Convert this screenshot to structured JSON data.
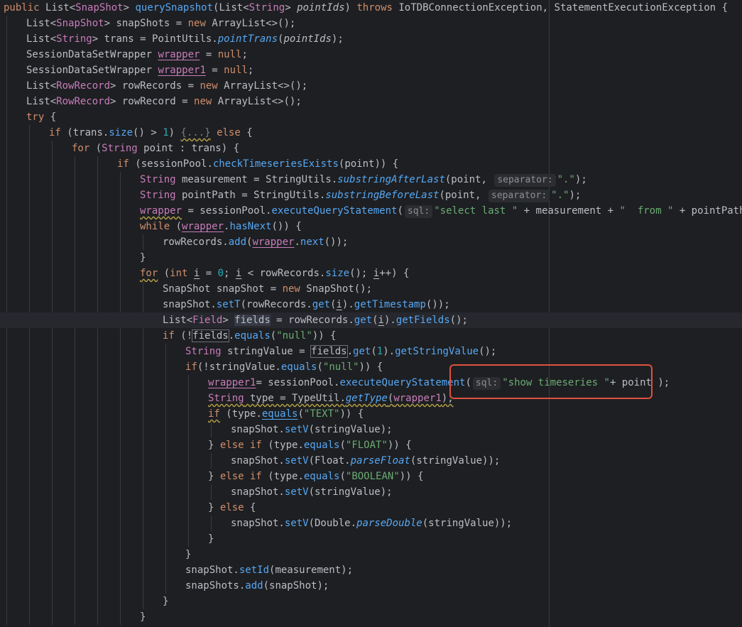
{
  "editor": {
    "lines": [
      {
        "indent": 0,
        "tokens": [
          {
            "t": "public ",
            "c": "kw"
          },
          {
            "t": "List<"
          },
          {
            "t": "SnapShot",
            "c": "ty"
          },
          {
            "t": "> "
          },
          {
            "t": "querySnapshot",
            "c": "fn"
          },
          {
            "t": "(List<"
          },
          {
            "t": "String",
            "c": "ty"
          },
          {
            "t": "> "
          },
          {
            "t": "pointIds",
            "c": "it"
          },
          {
            "t": ") "
          },
          {
            "t": "throws ",
            "c": "kw"
          },
          {
            "t": "IoTDBConnectionException, StatementExecutionException {"
          }
        ]
      },
      {
        "indent": 1,
        "tokens": [
          {
            "t": "List<"
          },
          {
            "t": "SnapShot",
            "c": "ty"
          },
          {
            "t": "> snapShots = "
          },
          {
            "t": "new ",
            "c": "kw"
          },
          {
            "t": "ArrayList<>();"
          }
        ]
      },
      {
        "indent": 1,
        "tokens": [
          {
            "t": "List<"
          },
          {
            "t": "String",
            "c": "ty"
          },
          {
            "t": "> trans = PointUtils."
          },
          {
            "t": "pointTrans",
            "c": "fn it"
          },
          {
            "t": "("
          },
          {
            "t": "pointIds",
            "c": "it"
          },
          {
            "t": ");"
          }
        ]
      },
      {
        "indent": 1,
        "tokens": [
          {
            "t": "SessionDataSetWrapper "
          },
          {
            "t": "wrapper",
            "c": "fd ul"
          },
          {
            "t": " = "
          },
          {
            "t": "null",
            "c": "kw"
          },
          {
            "t": ";"
          }
        ]
      },
      {
        "indent": 1,
        "tokens": [
          {
            "t": "SessionDataSetWrapper "
          },
          {
            "t": "wrapper1",
            "c": "fd ul"
          },
          {
            "t": " = "
          },
          {
            "t": "null",
            "c": "kw"
          },
          {
            "t": ";"
          }
        ]
      },
      {
        "indent": 1,
        "tokens": [
          {
            "t": "List<"
          },
          {
            "t": "RowRecord",
            "c": "ty"
          },
          {
            "t": "> rowRecords = "
          },
          {
            "t": "new ",
            "c": "kw"
          },
          {
            "t": "ArrayList<>();"
          }
        ]
      },
      {
        "indent": 1,
        "tokens": [
          {
            "t": "List<"
          },
          {
            "t": "RowRecord",
            "c": "ty"
          },
          {
            "t": "> rowRecord = "
          },
          {
            "t": "new ",
            "c": "kw"
          },
          {
            "t": "ArrayList<>();"
          }
        ]
      },
      {
        "indent": 1,
        "tokens": [
          {
            "t": "try ",
            "c": "kw"
          },
          {
            "t": "{"
          }
        ]
      },
      {
        "indent": 2,
        "tokens": [
          {
            "t": "if ",
            "c": "kw"
          },
          {
            "t": "(trans."
          },
          {
            "t": "size",
            "c": "fn"
          },
          {
            "t": "() > "
          },
          {
            "t": "1",
            "c": "nm"
          },
          {
            "t": ") "
          },
          {
            "t": "{...}",
            "c": "fold sq"
          },
          {
            "t": " else ",
            "c": "kw"
          },
          {
            "t": "{"
          }
        ]
      },
      {
        "indent": 3,
        "tokens": [
          {
            "t": "for ",
            "c": "kw"
          },
          {
            "t": "("
          },
          {
            "t": "String",
            "c": "ty"
          },
          {
            "t": " point : trans) {"
          }
        ]
      },
      {
        "indent": 5,
        "tokens": [
          {
            "t": "if ",
            "c": "kw"
          },
          {
            "t": "(sessionPool."
          },
          {
            "t": "checkTimeseriesExists",
            "c": "fn"
          },
          {
            "t": "(point)) {"
          }
        ]
      },
      {
        "indent": 6,
        "tokens": [
          {
            "t": "String",
            "c": "ty"
          },
          {
            "t": " measurement = StringUtils."
          },
          {
            "t": "substringAfterLast",
            "c": "fn it"
          },
          {
            "t": "(point, "
          },
          {
            "t": "separator:",
            "c": "hint"
          },
          {
            "t": "\".\"",
            "c": "st"
          },
          {
            "t": ");"
          }
        ]
      },
      {
        "indent": 6,
        "tokens": [
          {
            "t": "String",
            "c": "ty"
          },
          {
            "t": " pointPath = StringUtils."
          },
          {
            "t": "substringBeforeLast",
            "c": "fn it"
          },
          {
            "t": "(point, "
          },
          {
            "t": "separator:",
            "c": "hint"
          },
          {
            "t": "\".\"",
            "c": "st"
          },
          {
            "t": ");"
          }
        ]
      },
      {
        "indent": 6,
        "tokens": [
          {
            "t": "wrapper",
            "c": "fd sq"
          },
          {
            "t": " = sessionPool."
          },
          {
            "t": "executeQueryStatement",
            "c": "fn"
          },
          {
            "t": "("
          },
          {
            "t": "sql:",
            "c": "hint"
          },
          {
            "t": "\"select last \"",
            "c": "st"
          },
          {
            "t": " + measurement + "
          },
          {
            "t": "\"  from \"",
            "c": "st"
          },
          {
            "t": " + pointPath);"
          }
        ]
      },
      {
        "indent": 6,
        "tokens": [
          {
            "t": "while ",
            "c": "kw"
          },
          {
            "t": "("
          },
          {
            "t": "wrapper",
            "c": "fd ul"
          },
          {
            "t": "."
          },
          {
            "t": "hasNext",
            "c": "fn"
          },
          {
            "t": "()) {"
          }
        ]
      },
      {
        "indent": 7,
        "tokens": [
          {
            "t": "rowRecords."
          },
          {
            "t": "add",
            "c": "fn"
          },
          {
            "t": "("
          },
          {
            "t": "wrapper",
            "c": "fd ul"
          },
          {
            "t": "."
          },
          {
            "t": "next",
            "c": "fn"
          },
          {
            "t": "());"
          }
        ]
      },
      {
        "indent": 6,
        "tokens": [
          {
            "t": "}"
          }
        ]
      },
      {
        "indent": 6,
        "tokens": [
          {
            "t": "for",
            "c": "kw sq"
          },
          {
            "t": " ("
          },
          {
            "t": "int ",
            "c": "kw"
          },
          {
            "t": "i",
            "c": "ul"
          },
          {
            "t": " = "
          },
          {
            "t": "0",
            "c": "nm"
          },
          {
            "t": "; "
          },
          {
            "t": "i",
            "c": "ul"
          },
          {
            "t": " < rowRecords."
          },
          {
            "t": "size",
            "c": "fn"
          },
          {
            "t": "(); "
          },
          {
            "t": "i",
            "c": "ul"
          },
          {
            "t": "++) {"
          }
        ]
      },
      {
        "indent": 7,
        "tokens": [
          {
            "t": "SnapShot snapShot = "
          },
          {
            "t": "new ",
            "c": "kw"
          },
          {
            "t": "SnapShot();"
          }
        ]
      },
      {
        "indent": 7,
        "tokens": [
          {
            "t": "snapShot."
          },
          {
            "t": "setT",
            "c": "fn"
          },
          {
            "t": "(rowRecords."
          },
          {
            "t": "get",
            "c": "fn"
          },
          {
            "t": "("
          },
          {
            "t": "i",
            "c": "ul"
          },
          {
            "t": ")."
          },
          {
            "t": "getTimestamp",
            "c": "fn"
          },
          {
            "t": "());"
          }
        ]
      },
      {
        "indent": 7,
        "current": true,
        "tokens": [
          {
            "t": "List<"
          },
          {
            "t": "Field",
            "c": "ty"
          },
          {
            "t": "> "
          },
          {
            "t": "fields",
            "c": "refhl"
          },
          {
            "t": " = rowRecords."
          },
          {
            "t": "get",
            "c": "fn"
          },
          {
            "t": "("
          },
          {
            "t": "i",
            "c": "ul"
          },
          {
            "t": ")."
          },
          {
            "t": "getFields",
            "c": "fn"
          },
          {
            "t": "();"
          }
        ]
      },
      {
        "indent": 7,
        "tokens": [
          {
            "t": "if ",
            "c": "kw"
          },
          {
            "t": "(!"
          },
          {
            "t": "fields",
            "c": "boxed"
          },
          {
            "t": "."
          },
          {
            "t": "equals",
            "c": "fn"
          },
          {
            "t": "("
          },
          {
            "t": "\"null\"",
            "c": "st"
          },
          {
            "t": ")) {"
          }
        ]
      },
      {
        "indent": 8,
        "tokens": [
          {
            "t": "String",
            "c": "ty"
          },
          {
            "t": " stringValue = "
          },
          {
            "t": "fields",
            "c": "boxed"
          },
          {
            "t": "."
          },
          {
            "t": "get",
            "c": "fn"
          },
          {
            "t": "("
          },
          {
            "t": "1",
            "c": "nm"
          },
          {
            "t": ")."
          },
          {
            "t": "getStringValue",
            "c": "fn"
          },
          {
            "t": "();"
          }
        ]
      },
      {
        "indent": 8,
        "tokens": [
          {
            "t": "if",
            "c": "kw"
          },
          {
            "t": "(!stringValue."
          },
          {
            "t": "equals",
            "c": "fn"
          },
          {
            "t": "("
          },
          {
            "t": "\"null\"",
            "c": "st"
          },
          {
            "t": ")) {"
          }
        ]
      },
      {
        "indent": 9,
        "tokens": [
          {
            "t": "wrapper1",
            "c": "fd ul"
          },
          {
            "t": "= sessionPool."
          },
          {
            "t": "executeQueryStatement",
            "c": "fn"
          },
          {
            "t": "("
          },
          {
            "t": "sql:",
            "c": "hint"
          },
          {
            "t": "\"show timeseries \"",
            "c": "st"
          },
          {
            "t": "+ point );"
          }
        ]
      },
      {
        "indent": 9,
        "tokens": [
          {
            "t": "String",
            "c": "ty sq"
          },
          {
            "t": " type = TypeUtil.",
            "c": "sq"
          },
          {
            "t": "getType",
            "c": "fn it sq"
          },
          {
            "t": "(",
            "c": "sq"
          },
          {
            "t": "wrapper1",
            "c": "fd sq"
          },
          {
            "t": ");",
            "c": "sq"
          }
        ]
      },
      {
        "indent": 9,
        "tokens": [
          {
            "t": "if",
            "c": "kw sq"
          },
          {
            "t": " (type."
          },
          {
            "t": "equals",
            "c": "fn ul"
          },
          {
            "t": "("
          },
          {
            "t": "\"TEXT\"",
            "c": "st"
          },
          {
            "t": ")) {"
          }
        ]
      },
      {
        "indent": 10,
        "tokens": [
          {
            "t": "snapShot."
          },
          {
            "t": "setV",
            "c": "fn"
          },
          {
            "t": "(stringValue);"
          }
        ]
      },
      {
        "indent": 9,
        "tokens": [
          {
            "t": "} "
          },
          {
            "t": "else if ",
            "c": "kw"
          },
          {
            "t": "(type."
          },
          {
            "t": "equals",
            "c": "fn"
          },
          {
            "t": "("
          },
          {
            "t": "\"FLOAT\"",
            "c": "st"
          },
          {
            "t": ")) {"
          }
        ]
      },
      {
        "indent": 10,
        "tokens": [
          {
            "t": "snapShot."
          },
          {
            "t": "setV",
            "c": "fn"
          },
          {
            "t": "(Float."
          },
          {
            "t": "parseFloat",
            "c": "fn it"
          },
          {
            "t": "(stringValue));"
          }
        ]
      },
      {
        "indent": 9,
        "tokens": [
          {
            "t": "} "
          },
          {
            "t": "else if ",
            "c": "kw"
          },
          {
            "t": "(type."
          },
          {
            "t": "equals",
            "c": "fn"
          },
          {
            "t": "("
          },
          {
            "t": "\"BOOLEAN\"",
            "c": "st"
          },
          {
            "t": ")) {"
          }
        ]
      },
      {
        "indent": 10,
        "tokens": [
          {
            "t": "snapShot."
          },
          {
            "t": "setV",
            "c": "fn"
          },
          {
            "t": "(stringValue);"
          }
        ]
      },
      {
        "indent": 9,
        "tokens": [
          {
            "t": "} "
          },
          {
            "t": "else ",
            "c": "kw"
          },
          {
            "t": "{"
          }
        ]
      },
      {
        "indent": 10,
        "tokens": [
          {
            "t": "snapShot."
          },
          {
            "t": "setV",
            "c": "fn"
          },
          {
            "t": "(Double."
          },
          {
            "t": "parseDouble",
            "c": "fn it"
          },
          {
            "t": "(stringValue));"
          }
        ]
      },
      {
        "indent": 9,
        "tokens": [
          {
            "t": "}"
          }
        ]
      },
      {
        "indent": 8,
        "tokens": [
          {
            "t": "}"
          }
        ]
      },
      {
        "indent": 8,
        "tokens": [
          {
            "t": "snapShot."
          },
          {
            "t": "setId",
            "c": "fn"
          },
          {
            "t": "(measurement);"
          }
        ]
      },
      {
        "indent": 8,
        "tokens": [
          {
            "t": "snapShots."
          },
          {
            "t": "add",
            "c": "fn"
          },
          {
            "t": "(snapShot);"
          }
        ]
      },
      {
        "indent": 7,
        "tokens": [
          {
            "t": "}"
          }
        ]
      },
      {
        "indent": 6,
        "tokens": [
          {
            "t": "}"
          }
        ]
      }
    ]
  },
  "colors": {
    "background": "#1e1f22",
    "keyword": "#cf8e6d",
    "type": "#c77dbb",
    "method": "#56a8f5",
    "string": "#6aab73",
    "number": "#2aacb8",
    "highlight_box": "#e0513f"
  }
}
